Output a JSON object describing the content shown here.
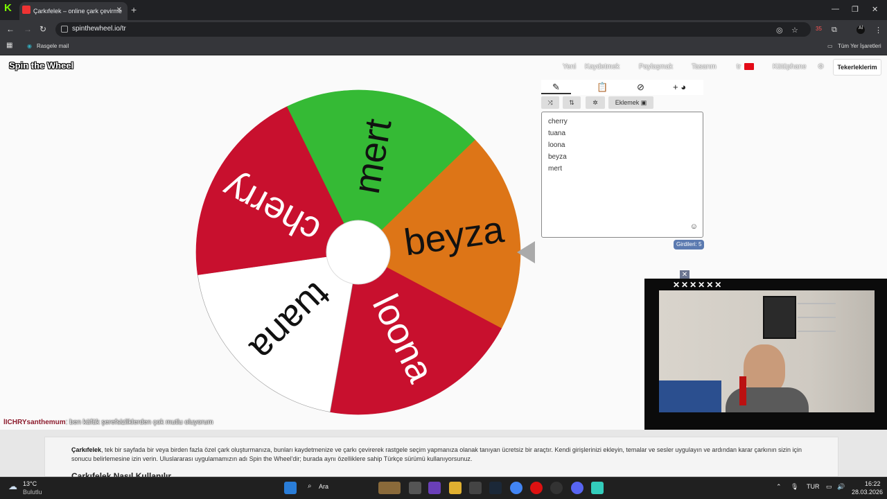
{
  "browser": {
    "tab_title": "Çarkıfelek – online çark çevirme",
    "url": "spinthewheel.io/tr",
    "bookmark_left": "Rasgele mail",
    "bookmark_right": "Tüm Yer İşaretleri",
    "extension_badge": "35"
  },
  "site": {
    "brand": "Spin the Wheel",
    "nav": {
      "new": "Yeni",
      "save": "Kaydetmek",
      "share": "Paylaşmak",
      "design": "Tasarım",
      "lang": "tr",
      "library": "Kütüphane",
      "my_wheels": "Tekerleklerim"
    },
    "panel": {
      "add_label": "Eklemek",
      "entries": [
        "cherry",
        "tuana",
        "loona",
        "beyza",
        "mert"
      ],
      "count_label": "Girdileri: 5"
    },
    "wheel": {
      "segments": [
        {
          "label": "beyza",
          "color": "#dd7517"
        },
        {
          "label": "loona",
          "color": "#c8102e"
        },
        {
          "label": "tuana",
          "color": "#ffffff"
        },
        {
          "label": "cherry",
          "color": "#c8102e"
        },
        {
          "label": "mert",
          "color": "#35ba35"
        }
      ]
    },
    "chat": {
      "user": "lICHRYsanthemum",
      "message": ": ben küfük şerefsizliklerden çok mutlu oluyorum"
    },
    "description": {
      "bold": "Çarkıfelek",
      "text": ", tek bir sayfada bir veya birden fazla özel çark oluşturmanıza, bunları kaydetmenize ve çarkı çevirerek rastgele seçim yapmanıza olanak tanıyan ücretsiz bir araçtır. Kendi girişlerinizi ekleyin, temalar ve sesler uygulayın ve ardından karar çarkının sizin için sonucu belirlemesine izin verin. Uluslararası uygulamamızın adı Spin the Wheel'dir; burada aynı özelliklere sahip Türkçe sürümü kullanıyorsunuz.",
      "heading": "Çarkıfelek Nasıl Kullanılır"
    }
  },
  "taskbar": {
    "weather_temp": "13°C",
    "weather_desc": "Bulutlu",
    "search": "Ara",
    "lang": "TUR",
    "time": "16:22",
    "date": "28.03.2026"
  }
}
